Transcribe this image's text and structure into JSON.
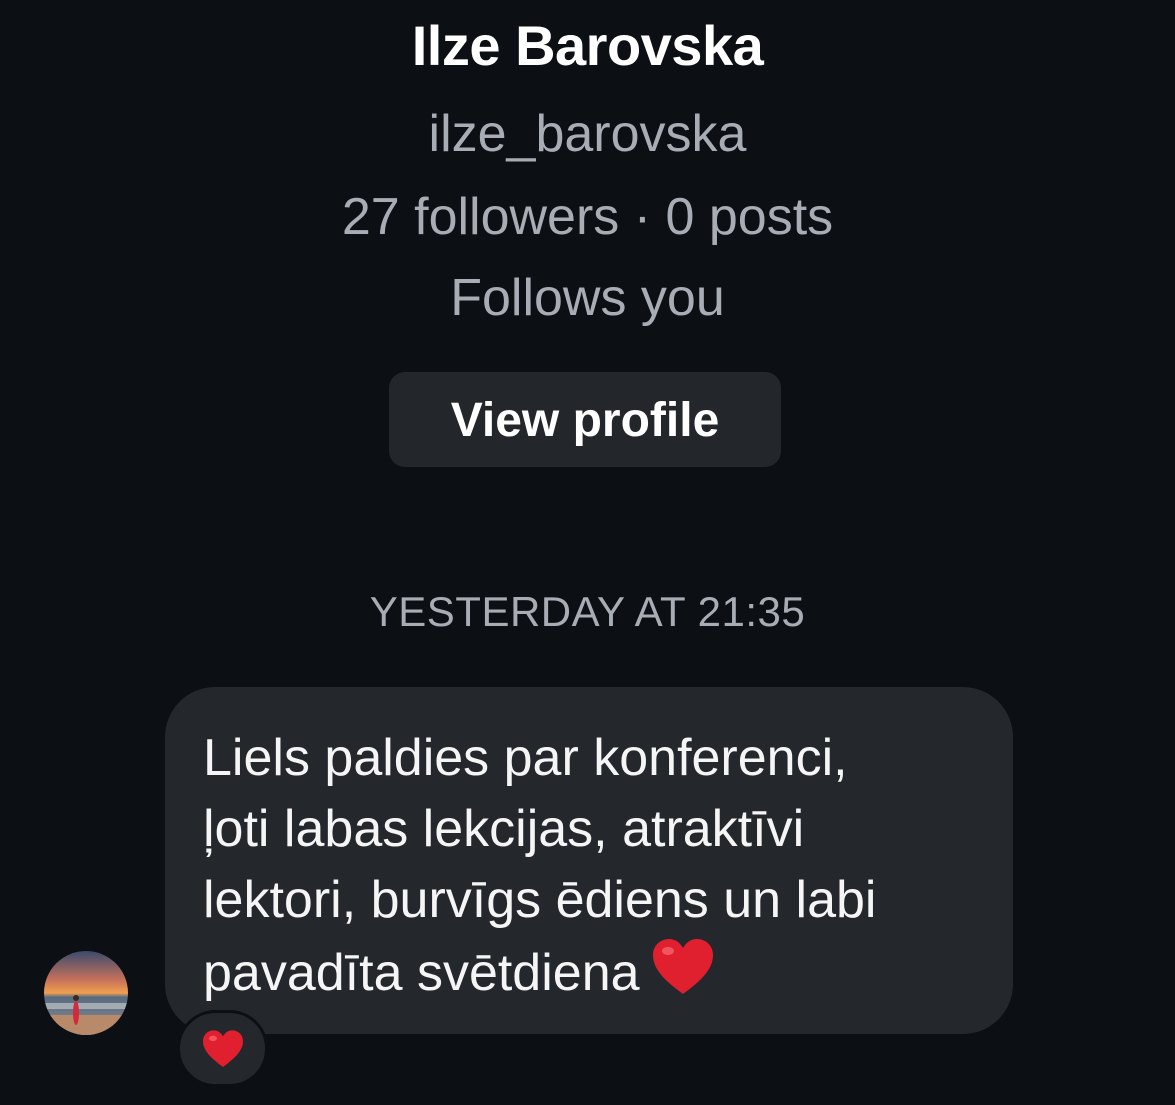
{
  "profile": {
    "display_name": "Ilze Barovska",
    "username": "ilze_barovska",
    "stats": "27 followers · 0 posts",
    "relationship": "Follows you",
    "view_profile_label": "View profile"
  },
  "thread": {
    "timestamp": "YESTERDAY AT 21:35",
    "messages": [
      {
        "text": "Liels paldies par konferenci,\nļoti labas lekcijas, atraktīvi\nlektori, burvīgs ēdiens un labi\npavadīta svētdiena",
        "trailing_emoji_icon": "red-heart-icon",
        "reaction_icon": "red-heart-icon",
        "sender_avatar": "avatar"
      }
    ]
  },
  "colors": {
    "background": "#0c1014",
    "bubble": "#24272c",
    "button": "#23262b",
    "secondary_text": "#a8adb5",
    "heart": "#e0202e"
  }
}
